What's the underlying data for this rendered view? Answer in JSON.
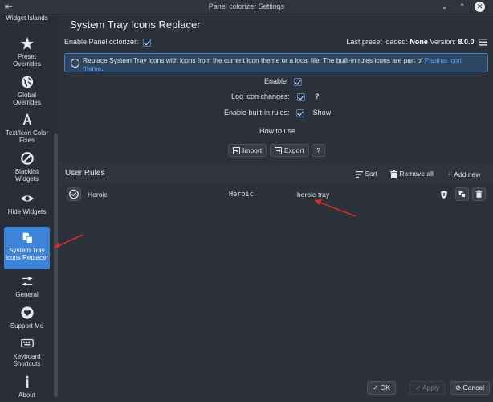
{
  "window": {
    "title": "Panel colorizer Settings"
  },
  "sidebar": {
    "items": [
      {
        "label": "Widget Islands",
        "icon": "widget-islands-icon"
      },
      {
        "label": "Preset Overrides",
        "icon": "star-icon"
      },
      {
        "label": "Global Overrides",
        "icon": "globe-icon"
      },
      {
        "label": "Text/Icon Color Fixes",
        "icon": "text-icon"
      },
      {
        "label": "Blacklist Widgets",
        "icon": "blocked-icon"
      },
      {
        "label": "Hide Widgets",
        "icon": "eye-icon"
      },
      {
        "label": "System Tray Icons Replacer",
        "icon": "tray-icon"
      },
      {
        "label": "General",
        "icon": "sliders-icon"
      },
      {
        "label": "Support Me",
        "icon": "heart-icon"
      },
      {
        "label": "Keyboard Shortcuts",
        "icon": "keyboard-icon"
      },
      {
        "label": "About",
        "icon": "info-icon"
      }
    ],
    "active_index": 6
  },
  "main": {
    "title": "System Tray Icons Replacer",
    "enable_colorizer_label": "Enable Panel colorizer:",
    "preset_loaded_label": "Last preset loaded:",
    "preset_loaded_value": "None",
    "version_label": "Version:",
    "version_value": "8.0.0",
    "info_text": "Replace System Tray icons with icons from the current icon theme or a local file. The built-in rules icons are part of ",
    "info_link": "Papirus icon theme",
    "info_end": ".",
    "enable_label": "Enable",
    "log_label": "Log icon changes:",
    "log_help": "?",
    "builtin_label": "Enable built-in rules:",
    "builtin_show": "Show",
    "how_to_use": "How to use",
    "import_label": "Import",
    "export_label": "Export",
    "help_label": "?"
  },
  "rules": {
    "header": "User Rules",
    "sort_label": "Sort",
    "remove_all_label": "Remove all",
    "add_new_label": "Add new",
    "items": [
      {
        "name": "Heroic",
        "match": "Heroic",
        "icon": "heroic-tray"
      }
    ]
  },
  "footer": {
    "ok_label": "OK",
    "apply_label": "Apply",
    "cancel_label": "Cancel"
  },
  "colors": {
    "accent": "#3d84d9",
    "annotation_arrow": "#d32d2d"
  }
}
